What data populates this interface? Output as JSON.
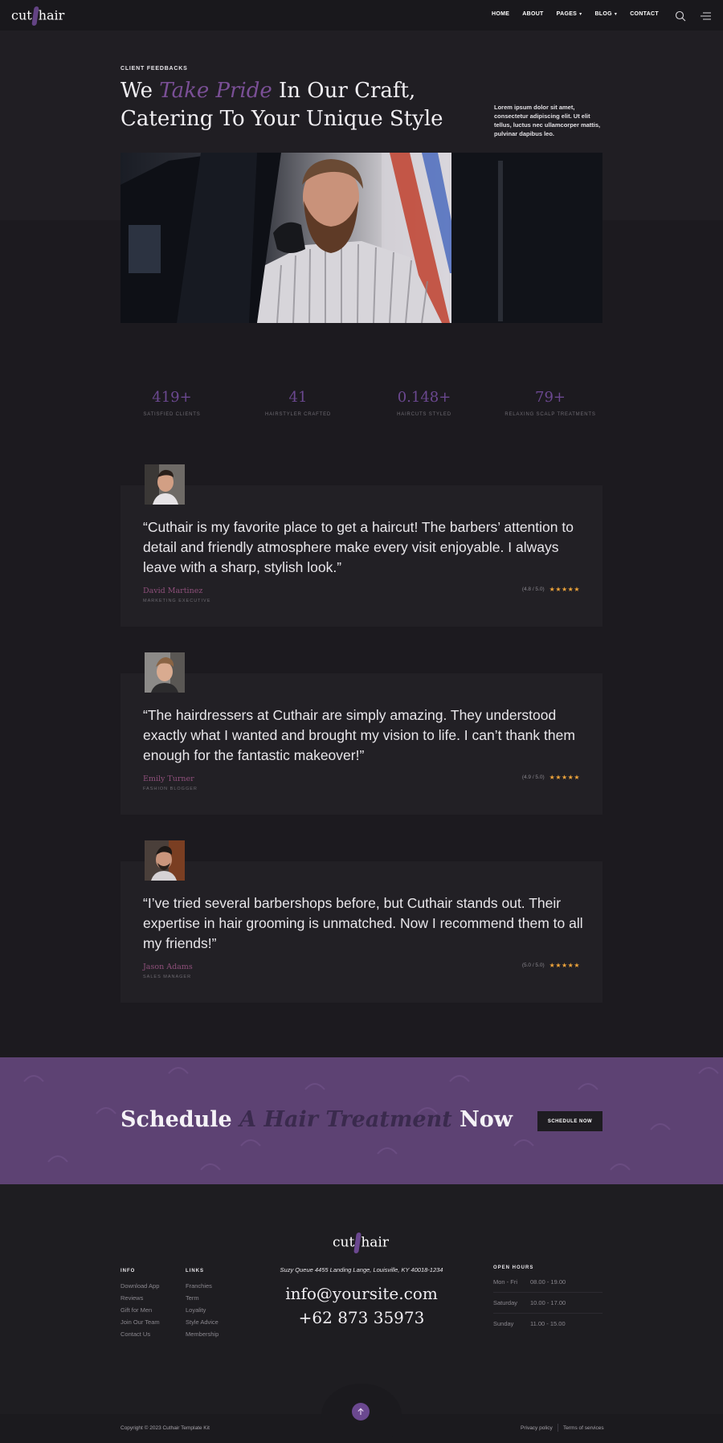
{
  "header": {
    "logo_left": "cut",
    "logo_right": "hair",
    "nav": [
      "HOME",
      "ABOUT",
      "PAGES",
      "BLOG",
      "CONTACT"
    ],
    "icons": [
      "search-icon",
      "menu-icon"
    ]
  },
  "hero": {
    "eyebrow": "CLIENT FEEDBACKS",
    "title_pre": "We ",
    "title_accent": "Take Pride",
    "title_post": " In Our Craft, Catering To Your Unique Style",
    "text": "Lorem ipsum dolor sit amet, consectetur adipiscing elit. Ut elit tellus, luctus nec ullamcorper mattis, pulvinar dapibus leo."
  },
  "stats": [
    {
      "value": "419+",
      "label": "SATISFIED CLIENTS"
    },
    {
      "value": "41",
      "label": "HAIRSTYLER CRAFTED"
    },
    {
      "value": "0.148+",
      "label": "HAIRCUTS STYLED"
    },
    {
      "value": "79+",
      "label": "RELAXING SCALP TREATMENTS"
    }
  ],
  "testimonials": [
    {
      "quote": "“Cuthair is my favorite place to get a haircut! The barbers’ attention to detail and friendly atmosphere make every visit enjoyable. I always leave with a sharp, stylish look.”",
      "name": "David Martinez",
      "role": "MARKETING EXECUTIVE",
      "rating": "(4.8 / 5.0)",
      "stars": "★★★★★"
    },
    {
      "quote": "“The hairdressers at Cuthair are simply amazing. They understood exactly what I wanted and brought my vision to life. I can’t thank them enough for the fantastic makeover!”",
      "name": "Emily Turner",
      "role": "FASHION BLOGGER",
      "rating": "(4.9 / 5.0)",
      "stars": "★★★★★"
    },
    {
      "quote": "“I’ve tried several barbershops before, but Cuthair stands out. Their expertise in hair grooming is unmatched. Now I recommend them to all my friends!”",
      "name": "Jason Adams",
      "role": "SALES MANAGER",
      "rating": "(5.0 / 5.0)",
      "stars": "★★★★★"
    }
  ],
  "cta": {
    "pre": "Schedule ",
    "accent": "A Hair Treatment",
    "post": " Now",
    "button": "SCHEDULE NOW"
  },
  "footer": {
    "logo_left": "cut",
    "logo_right": "hair",
    "info_head": "INFO",
    "info_links": [
      "Download App",
      "Reviews",
      "Gift for Men",
      "Join Our Team",
      "Contact Us"
    ],
    "links_head": "LINKS",
    "links": [
      "Franchies",
      "Term",
      "Loyality",
      "Style Advice",
      "Membership"
    ],
    "address": "Suzy Queue 4455 Landing Lange, Louisville, KY 40018-1234",
    "email": "info@yoursite.com",
    "phone": "+62 873 35973",
    "hours_head": "OPEN HOURS",
    "hours": [
      {
        "day": "Mon - Fri",
        "time": "08.00 - 19.00"
      },
      {
        "day": "Saturday",
        "time": "10.00 - 17.00"
      },
      {
        "day": "Sunday",
        "time": "11.00 - 15.00"
      }
    ],
    "copyright": "Copyright © 2023 Cuthair Template Kit",
    "privacy": "Privacy policy",
    "terms": "Terms of services"
  },
  "colors": {
    "accent": "#6b4890",
    "cta_bg": "#5d4273",
    "name": "#8e4f7a",
    "star": "#f0a43a"
  }
}
